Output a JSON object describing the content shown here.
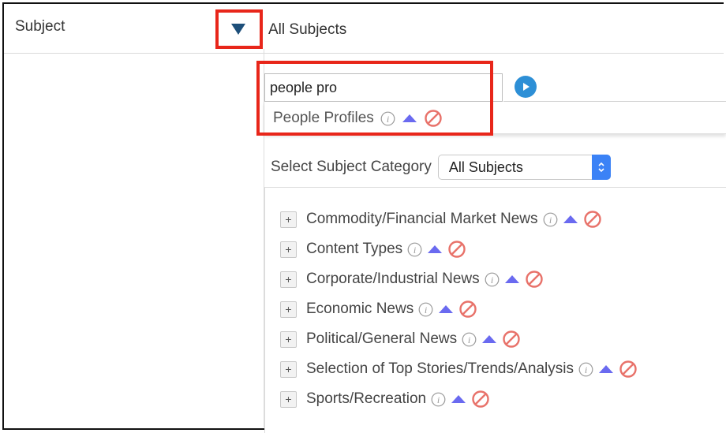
{
  "field_label": "Subject",
  "selected_subject": "All Subjects",
  "search": {
    "value": "people pro"
  },
  "suggestion": {
    "label": "People Profiles"
  },
  "category": {
    "label": "Select Subject Category",
    "selected": "All Subjects"
  },
  "tree_items": [
    {
      "label": "Commodity/Financial Market News"
    },
    {
      "label": "Content Types"
    },
    {
      "label": "Corporate/Industrial News"
    },
    {
      "label": "Economic News"
    },
    {
      "label": "Political/General News"
    },
    {
      "label": "Selection of Top Stories/Trends/Analysis"
    },
    {
      "label": "Sports/Recreation"
    }
  ],
  "tree_expand_symbol": "+",
  "colors": {
    "highlight": "#e8261a",
    "up_arrow": "#6a6af0",
    "block": "#e8726a",
    "go_button": "#2d8fd6",
    "select_arrows": "#3b82f6",
    "toggle_arrow": "#1d4f7a"
  },
  "icons": [
    "caret-down-icon",
    "play-circle-icon",
    "info-icon",
    "up-arrow-icon",
    "block-icon",
    "plus-icon",
    "select-arrows-icon"
  ]
}
